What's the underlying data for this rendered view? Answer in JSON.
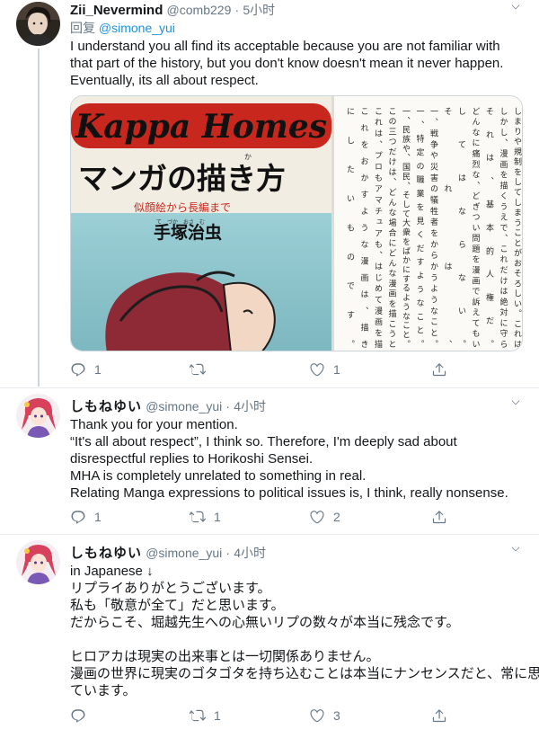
{
  "tweets": [
    {
      "author_name": "Zii_Nevermind",
      "handle": "@comb229",
      "time": "5小时",
      "reply_prefix": "回复",
      "reply_to": "@simone_yui",
      "lines": [
        "I understand you all find its acceptable because you are not familiar with",
        "that part of the history, but you don't know doesn't mean it never happen.",
        "Eventually, its all about respect."
      ],
      "media": {
        "book_series": "Kappa Homes",
        "book_title": "マンガの描き方",
        "book_subtitle": "似顔絵から長編まで",
        "book_author_ruby": "て　づか　おさ　む",
        "book_author": "手塚治虫",
        "book_ruby_ka": "か",
        "page_columns": [
          "しまりや規制をしてしまうことがおそろしい。これは",
          "しかし、漫画を描くうえで、これだけは絶対に守ら",
          "それは、基本的人権だ。",
          "どんなに痛烈な、どぎつい問題を漫画で訴えてもい",
          "してはならない。",
          "それは、",
          "一、戦争や災害の犠牲者をからかうようなこと。",
          "一、特定の職業を見くだすようなこと。",
          "一、民族や、国民、そして大衆をばかにするようなこと。",
          "この三つだけは、どんな場合にどんな漫画を描こうと",
          "これは、プロもアマチュアも、はじめて漫画を描",
          "これをおかすような漫画は、描き",
          "にしたいものです。"
        ]
      },
      "actions": {
        "reply": "1",
        "retweet": "",
        "like": "1"
      }
    },
    {
      "author_name": "しもねゆい",
      "handle": "@simone_yui",
      "time": "4小时",
      "lines": [
        "Thank you for your mention.",
        "“It's all about respect”, I think so. Therefore, I'm deeply sad about",
        "disrespectful replies to Horikoshi Sensei.",
        "MHA is completely unrelated to something in real.",
        "Relating Manga expressions to political issues is, I think, really nonsense."
      ],
      "actions": {
        "reply": "1",
        "retweet": "1",
        "like": "2"
      }
    },
    {
      "author_name": "しもねゆい",
      "handle": "@simone_yui",
      "time": "4小时",
      "lines": [
        "in Japanese ↓",
        "リプライありがとうございます。",
        "私も「敬意が全て」だと思います。",
        "だからこそ、堀越先生への心無いリプの数々が本当に残念です。",
        "",
        "ヒロアカは現実の出来事とは一切関係ありません。",
        "漫画の世界に現実のゴタゴタを持ち込むことは本当にナンセンスだと、常に思っ",
        "ています。"
      ],
      "actions": {
        "reply": "0",
        "retweet": "1",
        "like": "3"
      }
    }
  ],
  "colors": {
    "text": "#14171a",
    "secondary": "#657786",
    "link": "#1b95e0",
    "border": "#e6ecf0",
    "thread_line": "#ccd6dd",
    "book_red": "#c8271e",
    "book_teal": "#8cc3cc"
  },
  "icons": [
    "reply-icon",
    "retweet-icon",
    "like-icon",
    "share-icon",
    "more-caret-icon"
  ]
}
